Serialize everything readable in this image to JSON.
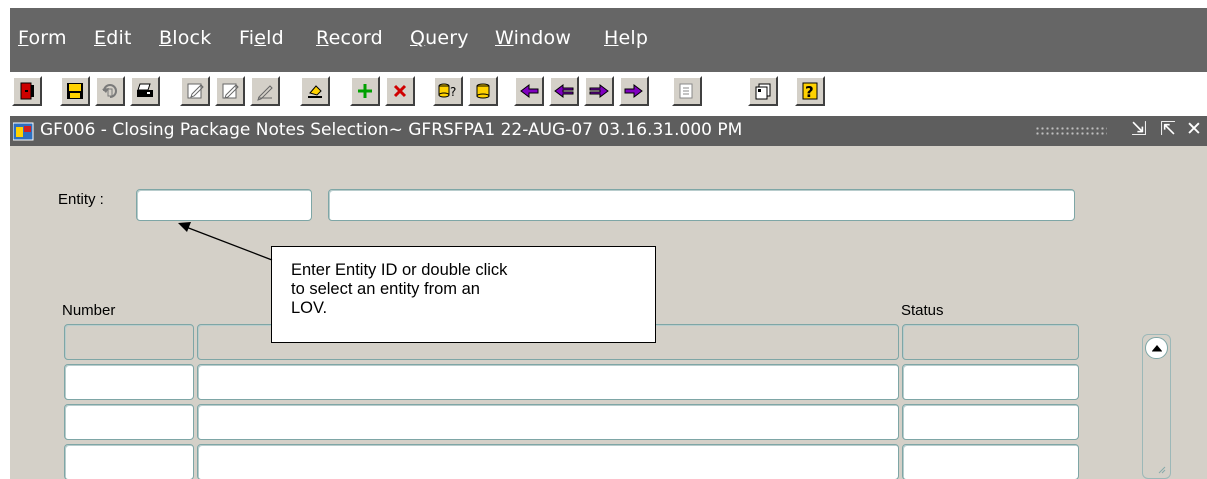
{
  "menubar": {
    "items": [
      {
        "acc": "F",
        "rest": "orm"
      },
      {
        "acc": "E",
        "rest": "dit"
      },
      {
        "acc": "B",
        "rest": "lock"
      },
      {
        "pre": "Fi",
        "acc": "e",
        "rest": "ld"
      },
      {
        "acc": "R",
        "rest": "ecord"
      },
      {
        "acc": "Q",
        "rest": "uery"
      },
      {
        "acc": "W",
        "rest": "indow"
      },
      {
        "acc": "H",
        "rest": "elp"
      }
    ]
  },
  "toolbar": {
    "icons": [
      "exit-icon",
      "save-icon",
      "rollback-icon",
      "print-icon",
      "edit-icon",
      "edit-record-icon",
      "edit-field-icon",
      "clear-icon",
      "insert-record-icon",
      "delete-record-icon",
      "query-help-icon",
      "execute-query-icon",
      "first-record-icon",
      "previous-record-icon",
      "next-record-icon",
      "last-record-icon",
      "list-icon",
      "window-icon",
      "help-icon"
    ]
  },
  "window": {
    "title": "GF006 - Closing Package Notes Selection~ GFRSFPA1  22-AUG-07 03.16.31.000 PM",
    "controls": {
      "minimize": "⇲",
      "maximize": "⇱",
      "close": "✕"
    }
  },
  "form": {
    "entity_label": "Entity :",
    "entity_id": "",
    "entity_name": "",
    "number_header": "Number",
    "status_header": "Status",
    "rows": [
      {
        "number": "",
        "description": "",
        "status": ""
      },
      {
        "number": "",
        "description": "",
        "status": ""
      },
      {
        "number": "",
        "description": "",
        "status": ""
      },
      {
        "number": "",
        "description": "",
        "status": ""
      }
    ]
  },
  "callout": {
    "lines": [
      "Enter Entity ID or double click",
      "to select an entity from an",
      "LOV."
    ]
  },
  "colors": {
    "menubar": "#666666",
    "titlebar": "#5e5e5e",
    "canvas": "#d4d0c8",
    "field_border": "#7ea6a6"
  }
}
